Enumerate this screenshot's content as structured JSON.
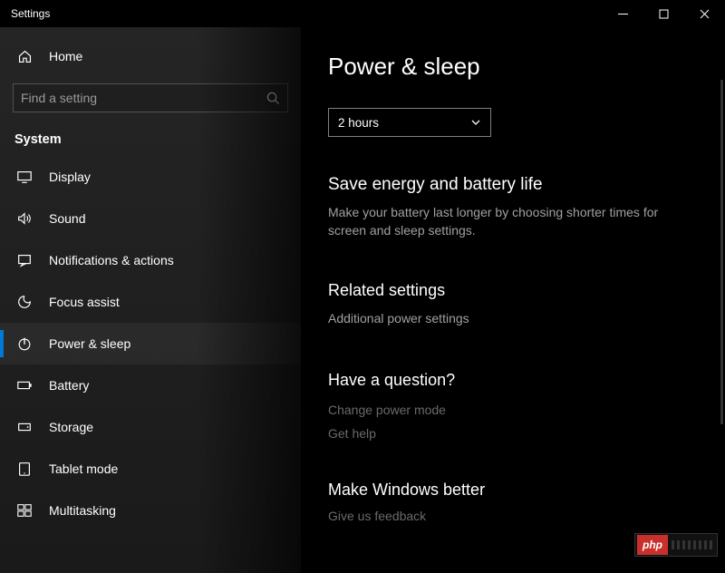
{
  "window": {
    "title": "Settings"
  },
  "sidebar": {
    "home": "Home",
    "searchPlaceholder": "Find a setting",
    "section": "System",
    "items": [
      {
        "label": "Display",
        "icon": "display-icon",
        "selected": false
      },
      {
        "label": "Sound",
        "icon": "sound-icon",
        "selected": false
      },
      {
        "label": "Notifications & actions",
        "icon": "notifications-icon",
        "selected": false
      },
      {
        "label": "Focus assist",
        "icon": "focus-icon",
        "selected": false
      },
      {
        "label": "Power & sleep",
        "icon": "power-icon",
        "selected": true
      },
      {
        "label": "Battery",
        "icon": "battery-icon",
        "selected": false
      },
      {
        "label": "Storage",
        "icon": "storage-icon",
        "selected": false
      },
      {
        "label": "Tablet mode",
        "icon": "tablet-icon",
        "selected": false
      },
      {
        "label": "Multitasking",
        "icon": "multitasking-icon",
        "selected": false
      }
    ]
  },
  "content": {
    "title": "Power & sleep",
    "dropdown": {
      "value": "2 hours"
    },
    "saveEnergy": {
      "heading": "Save energy and battery life",
      "text": "Make your battery last longer by choosing shorter times for screen and sleep settings."
    },
    "related": {
      "heading": "Related settings",
      "link": "Additional power settings"
    },
    "question": {
      "heading": "Have a question?",
      "link1": "Change power mode",
      "link2": "Get help"
    },
    "better": {
      "heading": "Make Windows better",
      "link": "Give us feedback"
    }
  },
  "annotation": {
    "color": "#ff0000"
  },
  "watermark": {
    "text": "php"
  }
}
